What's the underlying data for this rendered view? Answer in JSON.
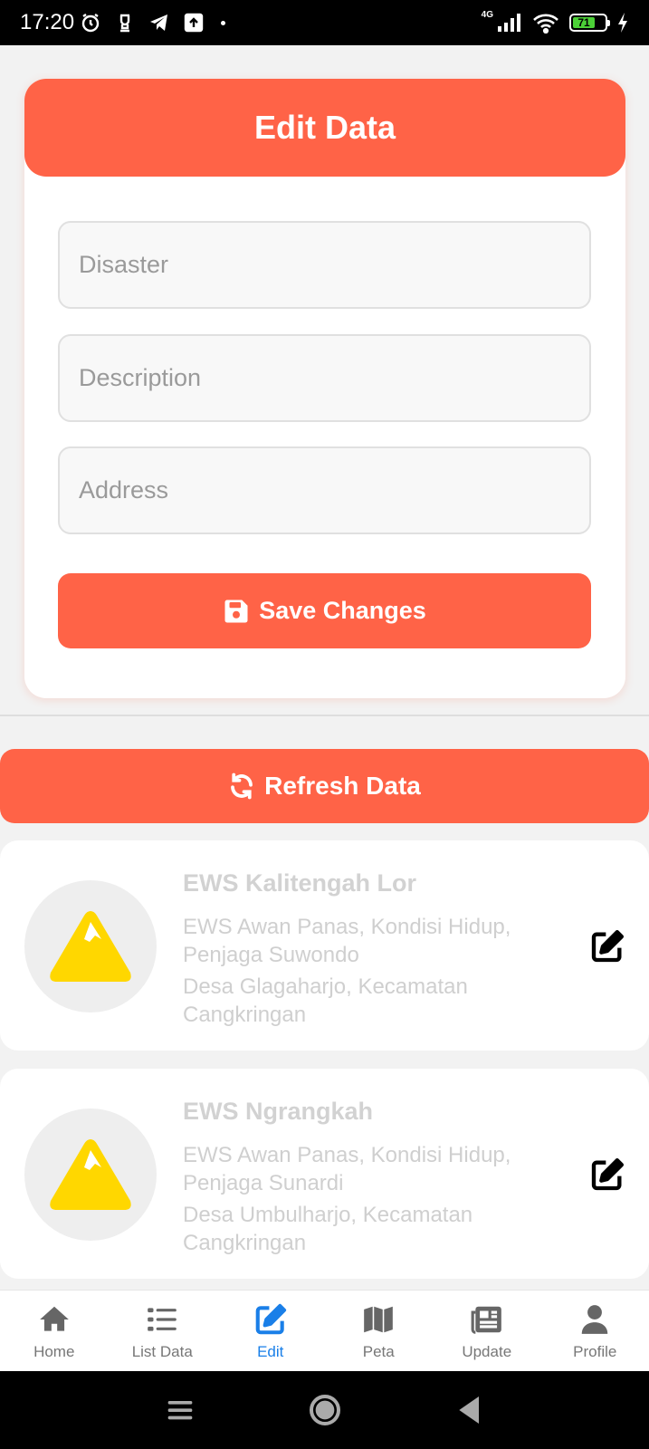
{
  "status_bar": {
    "time": "17:20",
    "network": "4G",
    "battery": "71",
    "icons": [
      "alarm-icon",
      "notification-icon",
      "telegram-icon",
      "upload-icon",
      "signal-icon",
      "wifi-icon",
      "battery-icon",
      "charging-icon"
    ]
  },
  "form": {
    "title": "Edit Data",
    "disaster_placeholder": "Disaster",
    "description_placeholder": "Description",
    "address_placeholder": "Address",
    "save_label": "Save Changes"
  },
  "refresh_label": "Refresh Data",
  "items": [
    {
      "title": "EWS Kalitengah Lor",
      "description": "EWS Awan Panas, Kondisi Hidup, Penjaga Suwondo",
      "address": "Desa Glagaharjo, Kecamatan Cangkringan"
    },
    {
      "title": "EWS Ngrangkah",
      "description": "EWS Awan Panas, Kondisi Hidup, Penjaga Sunardi",
      "address": "Desa Umbulharjo, Kecamatan Cangkringan"
    }
  ],
  "nav": {
    "items": [
      {
        "label": "Home",
        "icon": "home-icon"
      },
      {
        "label": "List Data",
        "icon": "list-icon"
      },
      {
        "label": "Edit",
        "icon": "edit-icon",
        "active": true
      },
      {
        "label": "Peta",
        "icon": "map-icon"
      },
      {
        "label": "Update",
        "icon": "newspaper-icon"
      },
      {
        "label": "Profile",
        "icon": "user-icon"
      }
    ]
  },
  "colors": {
    "accent": "#ff6347",
    "active_nav": "#1a7fe8",
    "mountain": "#ffd700"
  }
}
